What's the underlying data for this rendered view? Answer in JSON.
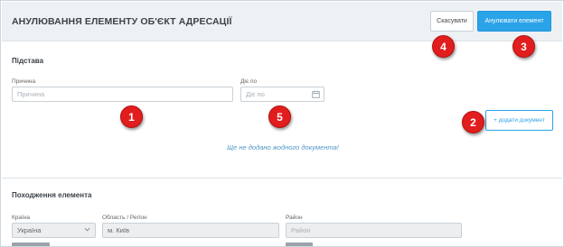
{
  "header": {
    "title": "АНУЛЮВАННЯ ЕЛЕМЕНТУ ОБ'ЄКТ АДРЕСАЦІЇ",
    "cancel_label": "Скасувати",
    "annul_label": "Анулювати елемент"
  },
  "basis": {
    "section_title": "Підстава",
    "reason_label": "Причина",
    "reason_placeholder": "Причина",
    "valid_until_label": "Діє по",
    "valid_until_placeholder": "Діє по",
    "add_document_label": "+ додати документ",
    "empty_message": "Ще не додано жодного документа!"
  },
  "origin": {
    "section_title": "Походження елемента",
    "country_label": "Країна",
    "country_value": "Україна",
    "region_label": "Область / Регіон",
    "region_value": "м. Київ",
    "district_label": "Район",
    "district_placeholder": "Район"
  },
  "markers": [
    "1",
    "2",
    "3",
    "4",
    "5"
  ],
  "colors": {
    "accent": "#2aa3e8",
    "marker": "#e11d1d",
    "header_bg": "#eef1f4",
    "empty_text": "#4f97c7"
  }
}
